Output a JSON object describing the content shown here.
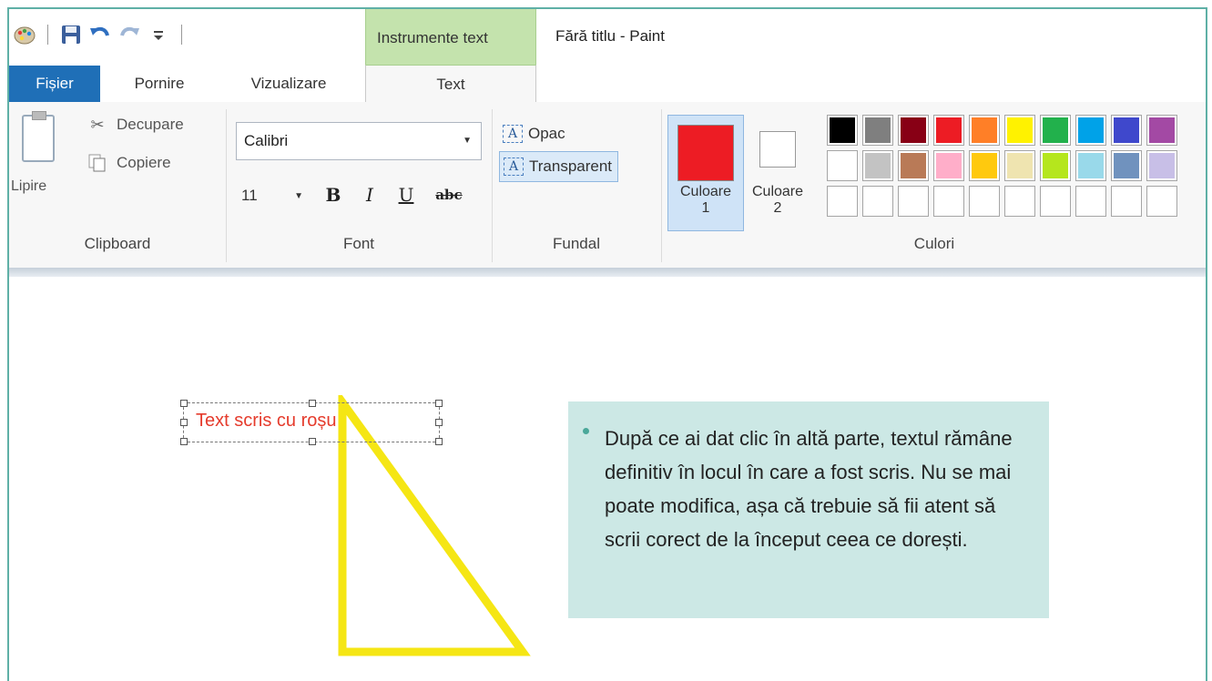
{
  "window": {
    "title": "Fără titlu - Paint",
    "context_tab_group": "Instrumente text"
  },
  "quick_access": {
    "icons": [
      "paint-app-icon",
      "save-icon",
      "undo-icon",
      "redo-icon",
      "customize-toolbar-icon"
    ]
  },
  "tabs": {
    "file": "Fișier",
    "home": "Pornire",
    "view": "Vizualizare",
    "text": "Text"
  },
  "clipboard": {
    "group_label": "Clipboard",
    "paste": "Lipire",
    "cut": "Decupare",
    "copy": "Copiere"
  },
  "font": {
    "group_label": "Font",
    "family": "Calibri",
    "size": "11",
    "bold": "B",
    "italic": "I",
    "underline": "U",
    "strikethrough": "abc"
  },
  "background": {
    "group_label": "Fundal",
    "opaque": "Opac",
    "transparent": "Transparent",
    "selected": "Transparent"
  },
  "colors": {
    "group_label": "Culori",
    "color1_label_line1": "Culoare",
    "color1_label_line2": "1",
    "color2_label_line1": "Culoare",
    "color2_label_line2": "2",
    "color1_value": "#ed1c24",
    "color2_value": "#ffffff",
    "palette_row1": [
      "#000000",
      "#7f7f7f",
      "#880015",
      "#ed1c24",
      "#ff7f27",
      "#fff200",
      "#22b14c",
      "#00a2e8",
      "#3f48cc",
      "#a349a4"
    ],
    "palette_row2": [
      "#ffffff",
      "#c3c3c3",
      "#b97a57",
      "#ffaec9",
      "#ffc90e",
      "#efe4b0",
      "#b5e61d",
      "#99d9ea",
      "#7092be",
      "#c8bfe7"
    ],
    "palette_row3": [
      "#ffffff",
      "#ffffff",
      "#ffffff",
      "#ffffff",
      "#ffffff",
      "#ffffff",
      "#ffffff",
      "#ffffff",
      "#ffffff",
      "#ffffff"
    ]
  },
  "canvas": {
    "text": "Text scris cu roșu",
    "text_color": "#e53b2c",
    "shape_color": "#f5e614"
  },
  "info_box": {
    "text": "După ce ai dat clic în altă parte, textul rămâne definitiv în locul în care a fost scris. Nu se mai poate modifica, așa că trebuie să fii atent să scrii corect de la început ceea ce dorești.",
    "background": "#cce8e5"
  }
}
